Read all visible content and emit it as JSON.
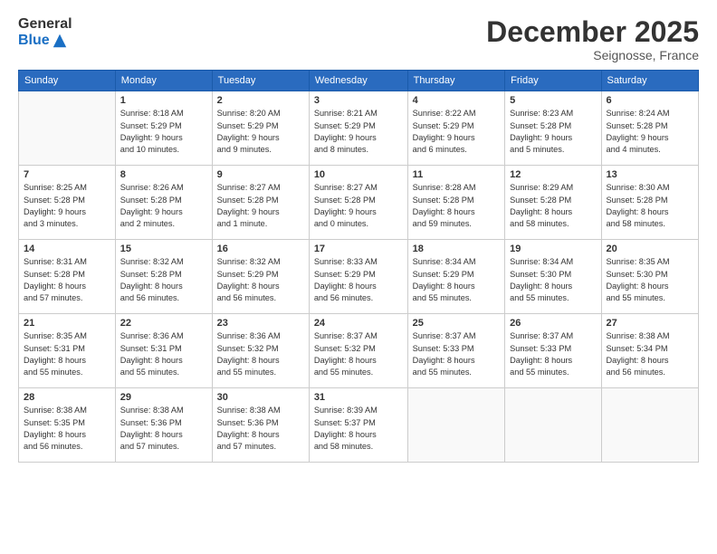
{
  "logo": {
    "general": "General",
    "blue": "Blue"
  },
  "header": {
    "month": "December 2025",
    "location": "Seignosse, France"
  },
  "weekdays": [
    "Sunday",
    "Monday",
    "Tuesday",
    "Wednesday",
    "Thursday",
    "Friday",
    "Saturday"
  ],
  "weeks": [
    [
      {
        "day": "",
        "info": ""
      },
      {
        "day": "1",
        "info": "Sunrise: 8:18 AM\nSunset: 5:29 PM\nDaylight: 9 hours\nand 10 minutes."
      },
      {
        "day": "2",
        "info": "Sunrise: 8:20 AM\nSunset: 5:29 PM\nDaylight: 9 hours\nand 9 minutes."
      },
      {
        "day": "3",
        "info": "Sunrise: 8:21 AM\nSunset: 5:29 PM\nDaylight: 9 hours\nand 8 minutes."
      },
      {
        "day": "4",
        "info": "Sunrise: 8:22 AM\nSunset: 5:29 PM\nDaylight: 9 hours\nand 6 minutes."
      },
      {
        "day": "5",
        "info": "Sunrise: 8:23 AM\nSunset: 5:28 PM\nDaylight: 9 hours\nand 5 minutes."
      },
      {
        "day": "6",
        "info": "Sunrise: 8:24 AM\nSunset: 5:28 PM\nDaylight: 9 hours\nand 4 minutes."
      }
    ],
    [
      {
        "day": "7",
        "info": "Sunrise: 8:25 AM\nSunset: 5:28 PM\nDaylight: 9 hours\nand 3 minutes."
      },
      {
        "day": "8",
        "info": "Sunrise: 8:26 AM\nSunset: 5:28 PM\nDaylight: 9 hours\nand 2 minutes."
      },
      {
        "day": "9",
        "info": "Sunrise: 8:27 AM\nSunset: 5:28 PM\nDaylight: 9 hours\nand 1 minute."
      },
      {
        "day": "10",
        "info": "Sunrise: 8:27 AM\nSunset: 5:28 PM\nDaylight: 9 hours\nand 0 minutes."
      },
      {
        "day": "11",
        "info": "Sunrise: 8:28 AM\nSunset: 5:28 PM\nDaylight: 8 hours\nand 59 minutes."
      },
      {
        "day": "12",
        "info": "Sunrise: 8:29 AM\nSunset: 5:28 PM\nDaylight: 8 hours\nand 58 minutes."
      },
      {
        "day": "13",
        "info": "Sunrise: 8:30 AM\nSunset: 5:28 PM\nDaylight: 8 hours\nand 58 minutes."
      }
    ],
    [
      {
        "day": "14",
        "info": "Sunrise: 8:31 AM\nSunset: 5:28 PM\nDaylight: 8 hours\nand 57 minutes."
      },
      {
        "day": "15",
        "info": "Sunrise: 8:32 AM\nSunset: 5:28 PM\nDaylight: 8 hours\nand 56 minutes."
      },
      {
        "day": "16",
        "info": "Sunrise: 8:32 AM\nSunset: 5:29 PM\nDaylight: 8 hours\nand 56 minutes."
      },
      {
        "day": "17",
        "info": "Sunrise: 8:33 AM\nSunset: 5:29 PM\nDaylight: 8 hours\nand 56 minutes."
      },
      {
        "day": "18",
        "info": "Sunrise: 8:34 AM\nSunset: 5:29 PM\nDaylight: 8 hours\nand 55 minutes."
      },
      {
        "day": "19",
        "info": "Sunrise: 8:34 AM\nSunset: 5:30 PM\nDaylight: 8 hours\nand 55 minutes."
      },
      {
        "day": "20",
        "info": "Sunrise: 8:35 AM\nSunset: 5:30 PM\nDaylight: 8 hours\nand 55 minutes."
      }
    ],
    [
      {
        "day": "21",
        "info": "Sunrise: 8:35 AM\nSunset: 5:31 PM\nDaylight: 8 hours\nand 55 minutes."
      },
      {
        "day": "22",
        "info": "Sunrise: 8:36 AM\nSunset: 5:31 PM\nDaylight: 8 hours\nand 55 minutes."
      },
      {
        "day": "23",
        "info": "Sunrise: 8:36 AM\nSunset: 5:32 PM\nDaylight: 8 hours\nand 55 minutes."
      },
      {
        "day": "24",
        "info": "Sunrise: 8:37 AM\nSunset: 5:32 PM\nDaylight: 8 hours\nand 55 minutes."
      },
      {
        "day": "25",
        "info": "Sunrise: 8:37 AM\nSunset: 5:33 PM\nDaylight: 8 hours\nand 55 minutes."
      },
      {
        "day": "26",
        "info": "Sunrise: 8:37 AM\nSunset: 5:33 PM\nDaylight: 8 hours\nand 55 minutes."
      },
      {
        "day": "27",
        "info": "Sunrise: 8:38 AM\nSunset: 5:34 PM\nDaylight: 8 hours\nand 56 minutes."
      }
    ],
    [
      {
        "day": "28",
        "info": "Sunrise: 8:38 AM\nSunset: 5:35 PM\nDaylight: 8 hours\nand 56 minutes."
      },
      {
        "day": "29",
        "info": "Sunrise: 8:38 AM\nSunset: 5:36 PM\nDaylight: 8 hours\nand 57 minutes."
      },
      {
        "day": "30",
        "info": "Sunrise: 8:38 AM\nSunset: 5:36 PM\nDaylight: 8 hours\nand 57 minutes."
      },
      {
        "day": "31",
        "info": "Sunrise: 8:39 AM\nSunset: 5:37 PM\nDaylight: 8 hours\nand 58 minutes."
      },
      {
        "day": "",
        "info": ""
      },
      {
        "day": "",
        "info": ""
      },
      {
        "day": "",
        "info": ""
      }
    ]
  ]
}
